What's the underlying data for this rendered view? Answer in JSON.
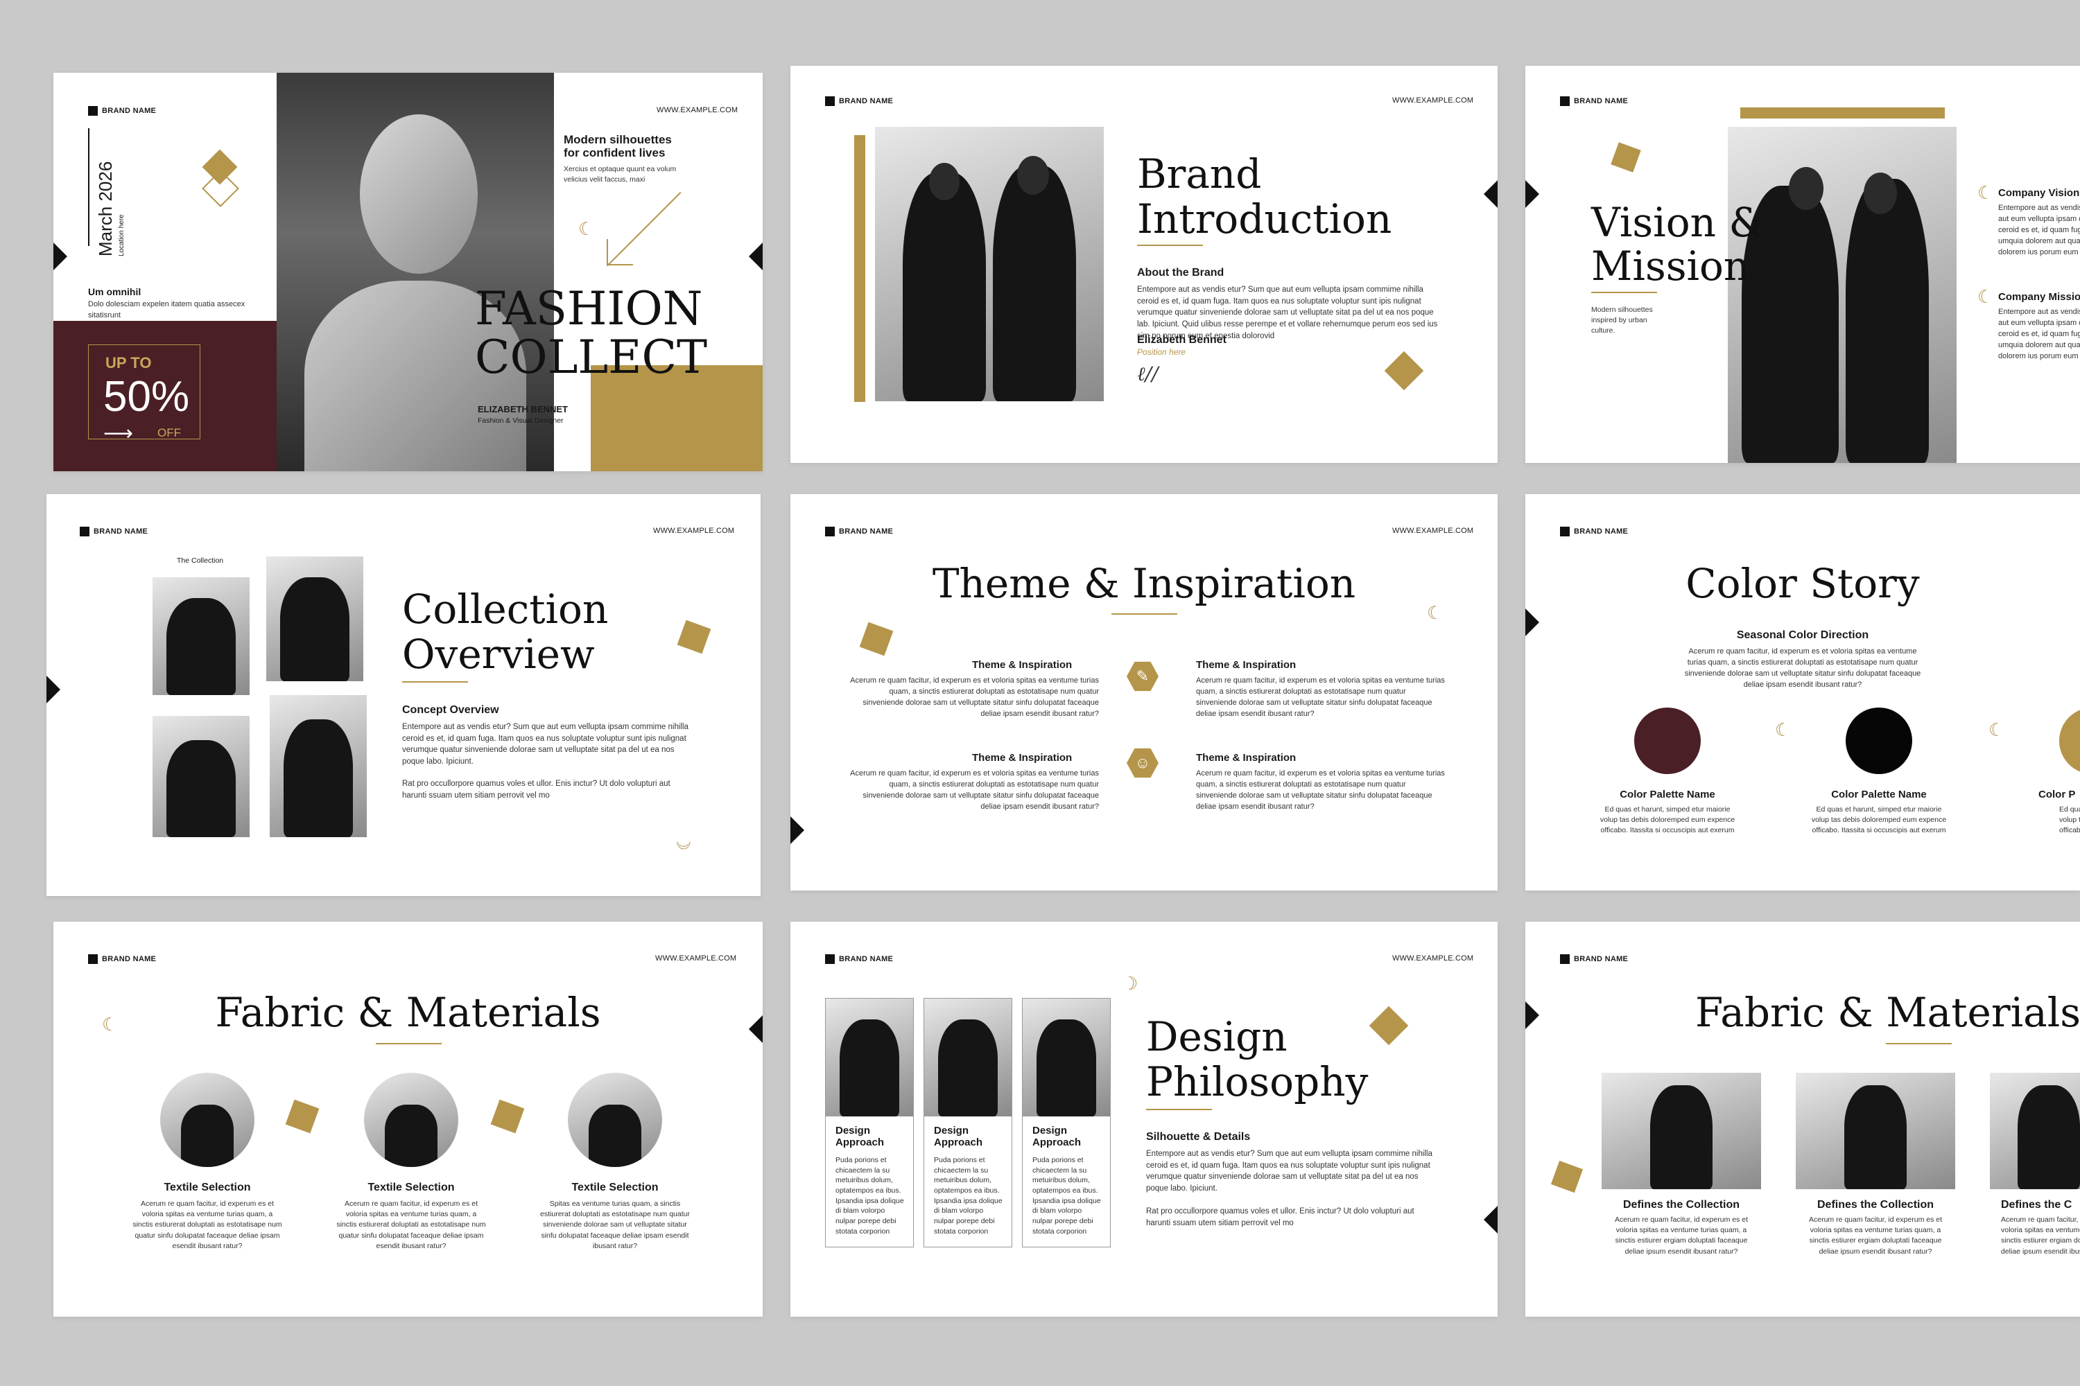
{
  "common": {
    "brand": "BRAND NAME",
    "url": "WWW.EXAMPLE.COM"
  },
  "s1": {
    "date": "March 2026",
    "location": "Location here",
    "intro_title": "Um omnihil",
    "intro_body": "Dolo dolesciam expelen itatem quatia assecex sitatisrunt",
    "promo_up": "UP TO",
    "promo_pct": "50%",
    "promo_off": "OFF",
    "tagline": "Modern silhouettes for confident lives",
    "tag_body": "Xercius et optaque quunt ea volum velicius velit faccus, maxi",
    "title_1": "FASHION",
    "title_2": "COLLECT",
    "name": "ELIZABETH BENNET",
    "role": "Fashion & Visual Designer"
  },
  "s2": {
    "title_1": "Brand",
    "title_2": "Introduction",
    "sub": "About the Brand",
    "body": "Entempore aut as vendis etur? Sum que aut eum vellupta ipsam commime nihilla ceroid es et, id quam fuga. Itam quos ea nus soluptate voluptur sunt ipis nulignat verumque quatur sinveniende dolorae sam ut velluptate sitat pa del ut ea nos poque lab. Ipiciunt. Quid ulibus resse perempe et et vollare rehernumque perum eos sed ius sim po porum eum et enestia dolorovid",
    "name": "Elizabeth Bennet",
    "role": "Position here"
  },
  "s3": {
    "title_1": "Vision &",
    "title_2": "Mission",
    "note": "Modern silhouettes inspired by urban culture.",
    "item1_title": "Company Vision",
    "item1_body": "Entempore aut as vendis etur? Sum que aut eum vellupta ipsam commime nihilla ceroid es et, id quam fuga. Itam quos ea umquia dolorem aut quas. Nam nulla dolorem ius porum eum et enestia",
    "item2_title": "Company Mission",
    "item2_body": "Entempore aut as vendis etur? Sum que aut eum vellupta ipsam commime nihilla ceroid es et, id quam fuga. Itam quos ea umquia dolorem aut quas. Nam nulla dolorem ius porum eum et enestia"
  },
  "s4": {
    "label": "The Collection",
    "title_1": "Collection",
    "title_2": "Overview",
    "sub": "Concept Overview",
    "body1": "Entempore aut as vendis etur? Sum que aut eum vellupta ipsam commime nihilla ceroid es et, id quam fuga. Itam quos ea nus soluptate voluptur sunt ipis nulignat verumque quatur sinveniende dolorae sam ut velluptate sitat pa del ut ea nos poque labo. Ipiciunt.",
    "body2": "Rat pro occullorpore quamus voles et ullor. Enis inctur? Ut dolo volupturi aut harunti ssuam utem sitiam perrovit vel mo"
  },
  "s5": {
    "title": "Theme & Inspiration",
    "item_title": "Theme & Inspiration",
    "item_body": "Acerum re quam facitur, id experum es et voloria spitas ea ventume turias quam, a sinctis estiurerat doluptati as estotatisape num quatur sinveniende dolorae sam ut velluptate sitatur sinfu dolupatat faceaque deliae ipsam esendit ibusant ratur?"
  },
  "s6": {
    "title": "Color Story",
    "sub": "Seasonal Color Direction",
    "body": "Acerum re quam facitur, id experum es et voloria spitas ea ventume turias quam, a sinctis estiurerat doluptati as estotatisape num quatur sinveniende dolorae sam ut velluptate sitatur sinfu dolupatat faceaque deliae ipsam esendit ibusant ratur?",
    "palette_label": "Color Palette Name",
    "palette_body": "Ed quas et harunt, simped etur maiorie volup tas debis doloremped eum expence officabo. Itassita si occuscipis aut exerum",
    "partial_label": "Color P",
    "colors": [
      "#4a1f25",
      "#060606",
      "#b4954a"
    ]
  },
  "s7": {
    "title": "Fabric & Materials",
    "item_title": "Textile Selection",
    "body_a": "Acerum re quam facitur, id experum es et voloria spitas ea ventume turias quam, a sinctis estiurerat doluptati as estotatisape num quatur sinfu dolupatat faceaque deliae ipsam esendit ibusant ratur?",
    "body_c": "Spitas ea ventume turias quam, a sinctis estiurerat doluptati as estotatisape num quatur sinveniende dolorae sam ut velluptate sitatur sinfu dolupatat faceaque deliae ipsam esendit ibusant ratur?"
  },
  "s8": {
    "card_title_1": "Design",
    "card_title_2": "Approach",
    "card_body": "Puda porions et chicaectem la su metuiribus dolum, optatempos ea ibus. Ipsandia ipsa dolique di blam volorpo nulpar porepe debi stotata corporion",
    "title_1": "Design",
    "title_2": "Philosophy",
    "sub": "Silhouette & Details",
    "body1": "Entempore aut as vendis etur? Sum que aut eum vellupta ipsam commime nihilla ceroid es et, id quam fuga. Itam quos ea nus soluptate voluptur sunt ipis nulignat verumque quatur sinveniende dolorae sam ut velluptate sitat pa del ut ea nos poque labo. Ipiciunt.",
    "body2": "Rat pro occullorpore quamus voles et ullor. Enis inctur? Ut dolo volupturi aut harunti ssuam utem sitiam perrovit vel mo"
  },
  "s9": {
    "title": "Fabric & Materials",
    "item_title": "Defines the Collection",
    "partial_title": "Defines the C",
    "body": "Acerum re quam facitur, id experum es et voloria spitas ea ventume turias quam, a sinctis estiurer ergiam doluptati faceaque deliae ipsum esendit ibusant ratur?"
  }
}
